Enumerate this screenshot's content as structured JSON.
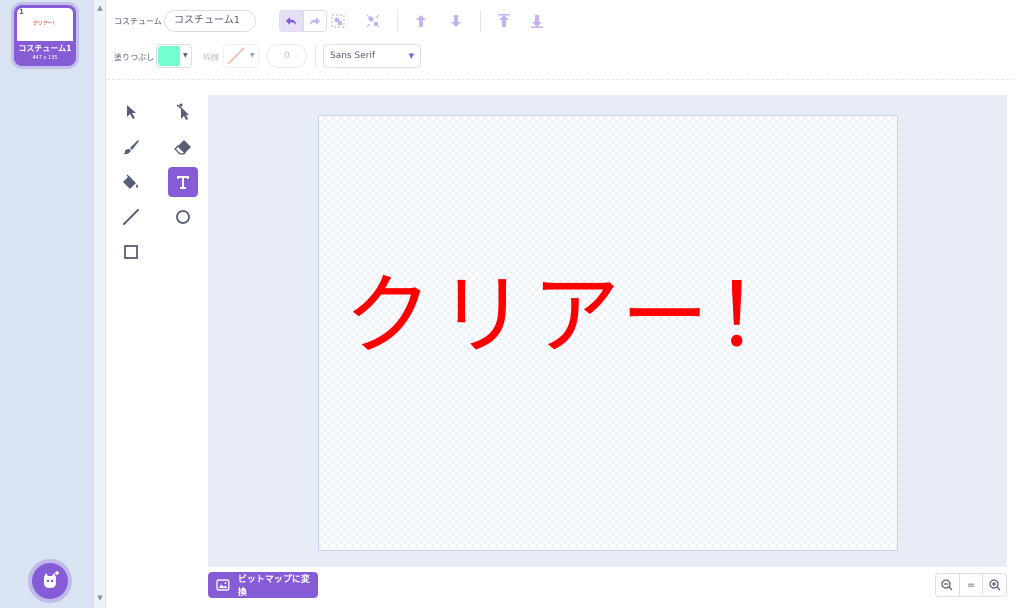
{
  "costume_list": {
    "selected_costume": {
      "number": "1",
      "thumbnail_text": "クリアー！",
      "name": "コスチューム1",
      "size": "447 x 135"
    },
    "choose_costume_icon": "cat-plus-icon"
  },
  "toolbar": {
    "costume_label": "コスチューム",
    "costume_name_value": "コスチューム1",
    "fill_label": "塗りつぶし",
    "fill_color": "#73ffd2",
    "stroke_label": "枠線",
    "stroke_width_value": "0",
    "font_value": "Sans Serif"
  },
  "canvas": {
    "text": "クリアー！",
    "text_color": "#ff0000"
  },
  "bottom": {
    "bitmap_button_label": "ビットマップに変換",
    "zoom_reset_label": "="
  },
  "colors": {
    "accent": "#855cd6",
    "sidebar_bg": "#d9e3f2"
  }
}
